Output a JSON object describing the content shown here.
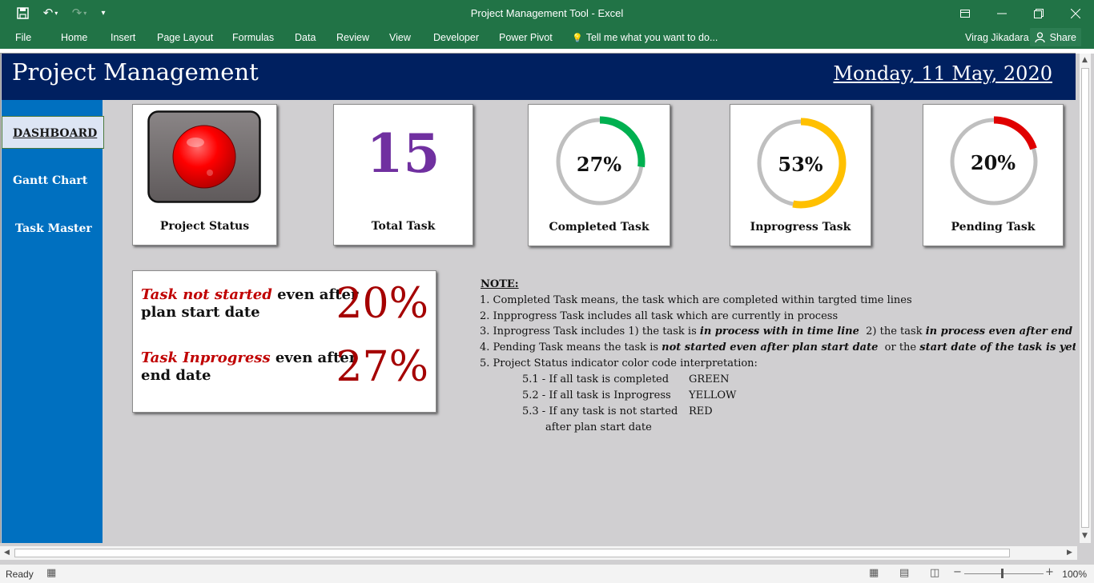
{
  "window": {
    "title": "Project Management Tool  -  Excel"
  },
  "ribbon": {
    "tabs": [
      "File",
      "Home",
      "Insert",
      "Page Layout",
      "Formulas",
      "Data",
      "Review",
      "View",
      "Developer",
      "Power Pivot"
    ],
    "tell_me": "Tell me what you want to do...",
    "user": "Virag Jikadara",
    "share": "Share"
  },
  "banner": {
    "title": "Project Management",
    "date": "Monday, 11 May, 2020"
  },
  "sidebar": {
    "items": [
      {
        "label": "DASHBOARD",
        "active": true
      },
      {
        "label": "Gantt Chart",
        "active": false
      },
      {
        "label": "Task Master",
        "active": false
      }
    ]
  },
  "kpis": {
    "project_status": {
      "label": "Project Status",
      "color": "#ff0000"
    },
    "total_task": {
      "label": "Total Task",
      "value": "15"
    },
    "completed": {
      "label": "Completed Task",
      "percent_text": "27%",
      "fraction": 0.27,
      "color": "#00b050"
    },
    "inprogress": {
      "label": "Inprogress Task",
      "percent_text": "53%",
      "fraction": 0.53,
      "color": "#ffc000"
    },
    "pending": {
      "label": "Pending Task",
      "percent_text": "20%",
      "fraction": 0.2,
      "color": "#e00000"
    }
  },
  "info": {
    "row1_em": "Task not started",
    "row1_rest_a": " even after",
    "row1_rest_b": "plan start date",
    "row1_pct": "20%",
    "row2_em": "Task Inprogress",
    "row2_rest_a": " even after",
    "row2_rest_b": "end date",
    "row2_pct": "27%"
  },
  "notes": {
    "heading": "NOTE:",
    "n1": "1. Completed Task means, the task which are completed within targted time lines",
    "n2": "2. Inpprogress Task includes all task which are currently in process",
    "n3_a": "3. Inprogress Task includes 1) the task is ",
    "n3_b": "in process with in time line",
    "n3_c": "  2) the task ",
    "n3_d": "in process even after end date",
    "n4_a": "4. Pending Task means the task is ",
    "n4_b": "not started even after plan start date",
    "n4_c": "  or the ",
    "n4_d": "start date of the task is yet to come",
    "n5": "5. Project Status indicator color code interpretation:",
    "s1": "5.1 - If all task is completed",
    "s1_color": "GREEN",
    "s2": "5.2 - If all task is Inprogress",
    "s2_color": "YELLOW",
    "s3": "5.3 - If any task is not started",
    "s3_color": "RED",
    "s3_cont": "after plan start date"
  },
  "status": {
    "ready": "Ready",
    "zoom": "100%"
  }
}
